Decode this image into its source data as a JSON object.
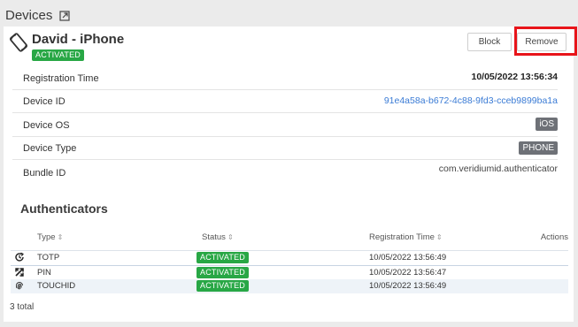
{
  "section": {
    "title": "Devices",
    "link_icon": "external-link-icon"
  },
  "device": {
    "icon": "device-rotate-icon",
    "name": "David - iPhone",
    "status": "ACTIVATED",
    "buttons": {
      "block": "Block",
      "remove": "Remove"
    },
    "fields": [
      {
        "label": "Registration Time",
        "value": "10/05/2022 13:56:34"
      },
      {
        "label": "Device ID",
        "value": "91e4a58a-b672-4c88-9fd3-cceb9899ba1a"
      },
      {
        "label": "Device OS",
        "value": "iOS"
      },
      {
        "label": "Device Type",
        "value": "PHONE"
      },
      {
        "label": "Bundle ID",
        "value": "com.veridiumid.authenticator"
      }
    ]
  },
  "authenticators": {
    "title": "Authenticators",
    "columns": {
      "type": "Type",
      "status": "Status",
      "registration_time": "Registration Time",
      "actions": "Actions"
    },
    "sort_glyph": "⇕",
    "rows": [
      {
        "icon": "clock-refresh-icon",
        "type": "TOTP",
        "status": "ACTIVATED",
        "registration_time": "10/05/2022 13:56:49"
      },
      {
        "icon": "pin-arrows-icon",
        "type": "PIN",
        "status": "ACTIVATED",
        "registration_time": "10/05/2022 13:56:47"
      },
      {
        "icon": "fingerprint-icon",
        "type": "TOUCHID",
        "status": "ACTIVATED",
        "registration_time": "10/05/2022 13:56:49"
      }
    ],
    "total": "3 total"
  },
  "colors": {
    "activated": "#28a745",
    "link": "#3a7bd5",
    "chip": "#6e7177",
    "highlight": "#e8141a"
  }
}
